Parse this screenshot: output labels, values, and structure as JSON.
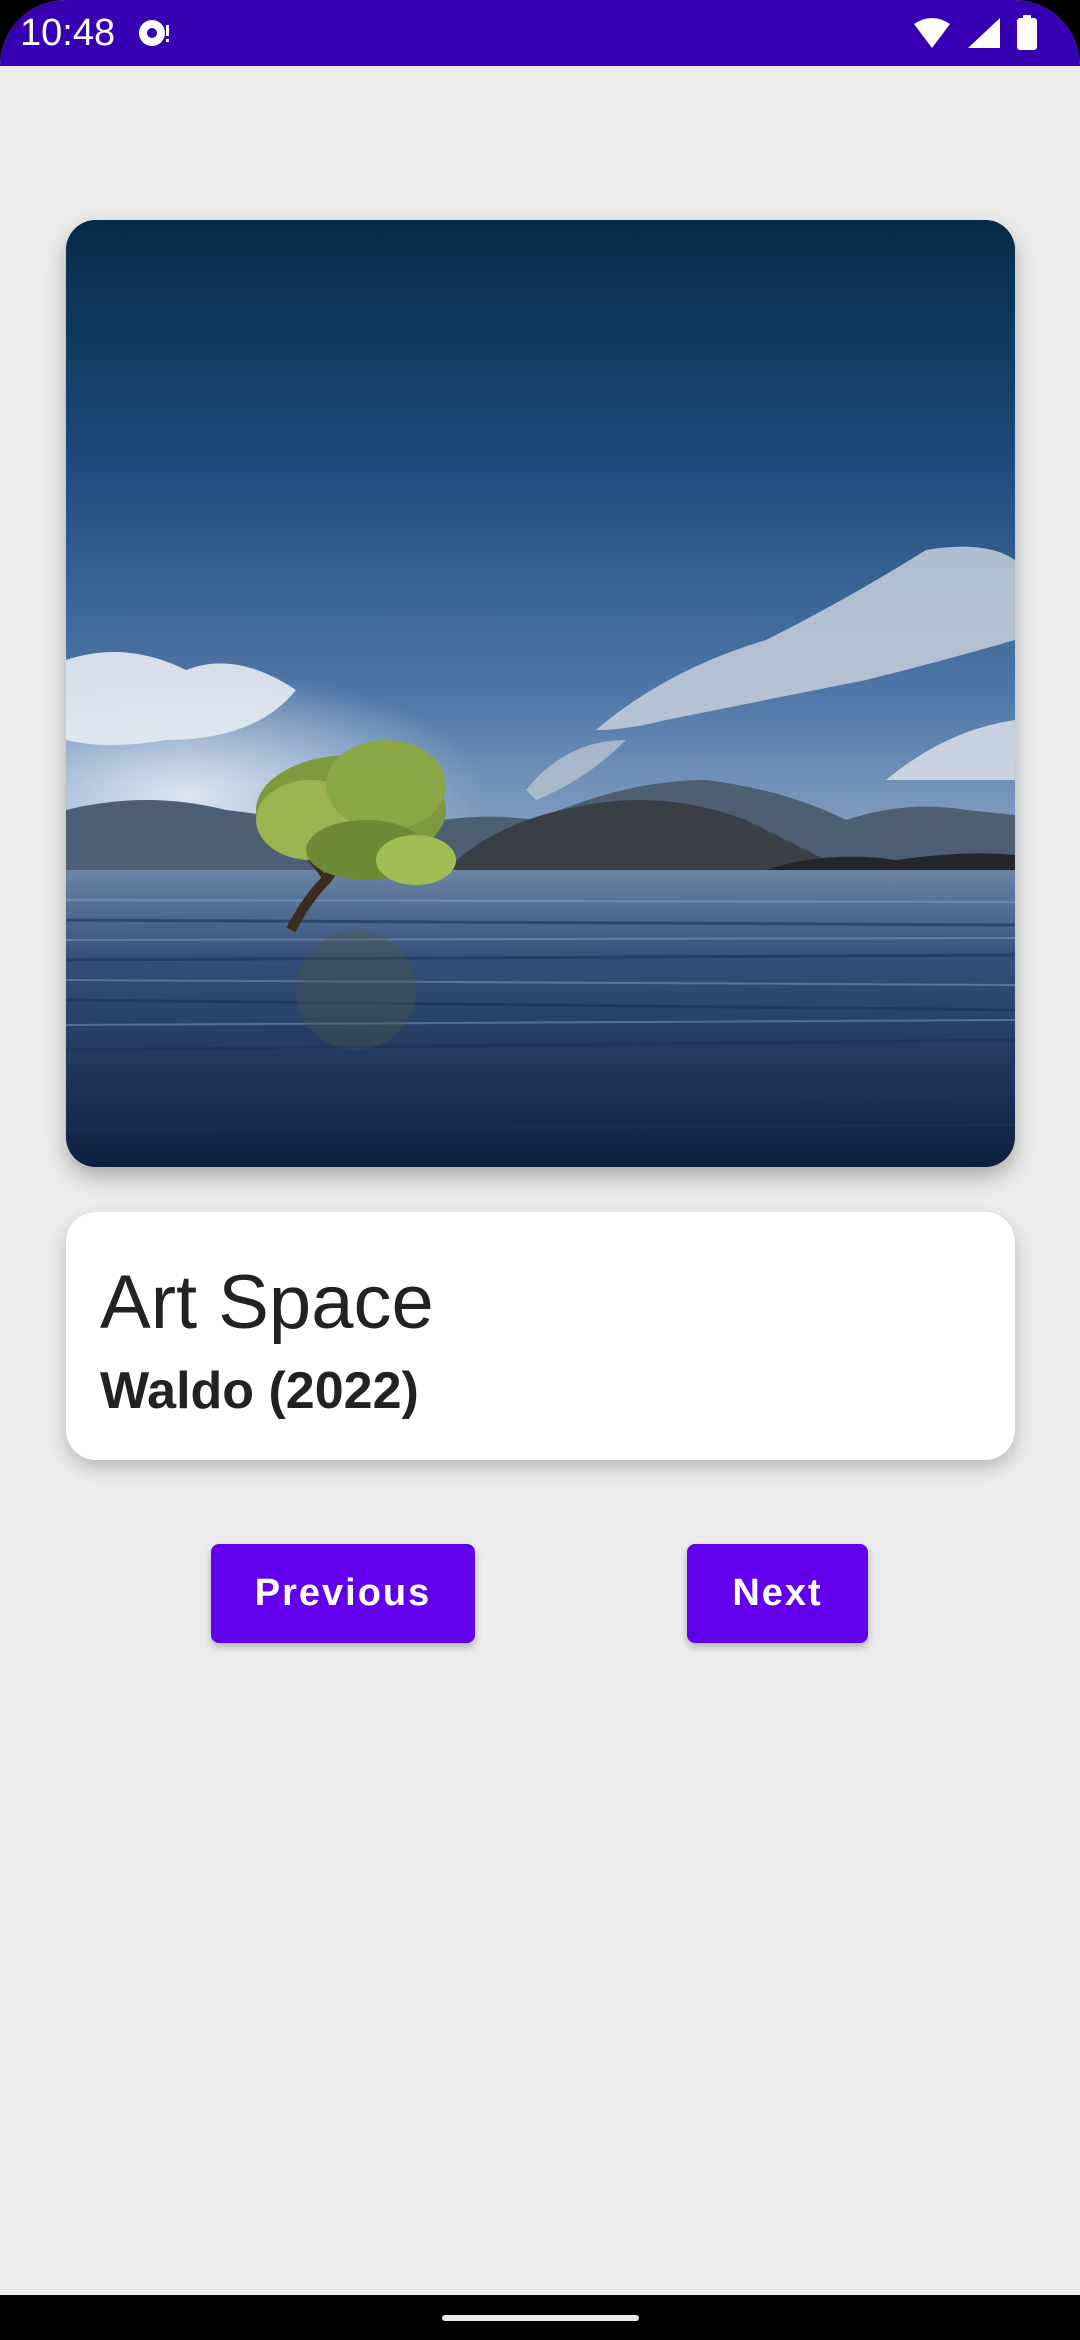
{
  "status_bar": {
    "time": "10:48",
    "notification_icon": "media-notification-icon",
    "wifi_icon": "wifi-icon",
    "signal_icon": "cell-signal-icon",
    "battery_icon": "battery-icon",
    "background": "#3700b3"
  },
  "artwork": {
    "image_description_icon": "lake-tree-landscape-image"
  },
  "info": {
    "title": "Art Space",
    "artist_year": "Waldo (2022)"
  },
  "buttons": {
    "previous_label": "Previous",
    "next_label": "Next",
    "color": "#6200ee"
  },
  "colors": {
    "screen_background": "#ececec",
    "card_background": "#ffffff"
  }
}
